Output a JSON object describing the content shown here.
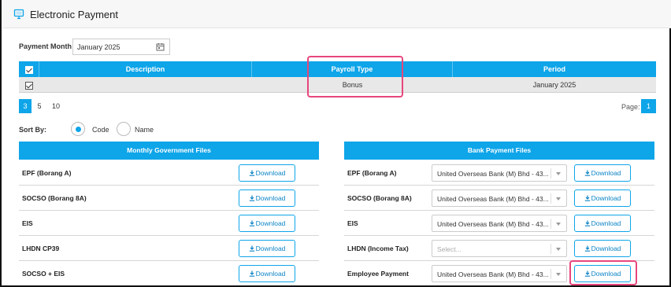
{
  "page": {
    "title": "Electronic Payment",
    "title_icon": "monitor-icon"
  },
  "payment_month": {
    "label": "Payment Month",
    "value": "January 2025",
    "icon": "calendar-icon"
  },
  "payroll_table": {
    "headers": {
      "description": "Description",
      "payroll_type": "Payroll Type",
      "period": "Period"
    },
    "rows": [
      {
        "description": "",
        "payroll_type": "Bonus",
        "period": "January 2025",
        "checked": true
      }
    ]
  },
  "pager": {
    "sizes": [
      "3",
      "5",
      "10"
    ],
    "active_size": "3",
    "page_label": "Page:",
    "current_page": "1"
  },
  "sort": {
    "label": "Sort By:",
    "options": [
      {
        "label": "Code",
        "selected": true
      },
      {
        "label": "Name",
        "selected": false
      }
    ]
  },
  "gov_files": {
    "header": "Monthly Government Files",
    "rows": [
      {
        "label": "EPF (Borang A)",
        "button": "Download"
      },
      {
        "label": "SOCSO (Borang 8A)",
        "button": "Download"
      },
      {
        "label": "EIS",
        "button": "Download"
      },
      {
        "label": "LHDN CP39",
        "button": "Download"
      },
      {
        "label": "SOCSO + EIS",
        "button": "Download"
      }
    ]
  },
  "bank_files": {
    "header": "Bank Payment Files",
    "rows": [
      {
        "label": "EPF (Borang A)",
        "bank": "United Overseas Bank (M) Bhd - 43...",
        "button": "Download"
      },
      {
        "label": "SOCSO (Borang 8A)",
        "bank": "United Overseas Bank (M) Bhd - 43...",
        "button": "Download"
      },
      {
        "label": "EIS",
        "bank": "United Overseas Bank (M) Bhd - 43...",
        "button": "Download"
      },
      {
        "label": "LHDN (Income Tax)",
        "bank": "Select...",
        "button": "Download"
      },
      {
        "label": "Employee Payment",
        "bank": "United Overseas Bank (M) Bhd - 43...",
        "button": "Download"
      }
    ]
  },
  "colors": {
    "accent": "#0ea5e9",
    "highlight": "#e8467c",
    "row_selected": "#e8e8e8"
  }
}
